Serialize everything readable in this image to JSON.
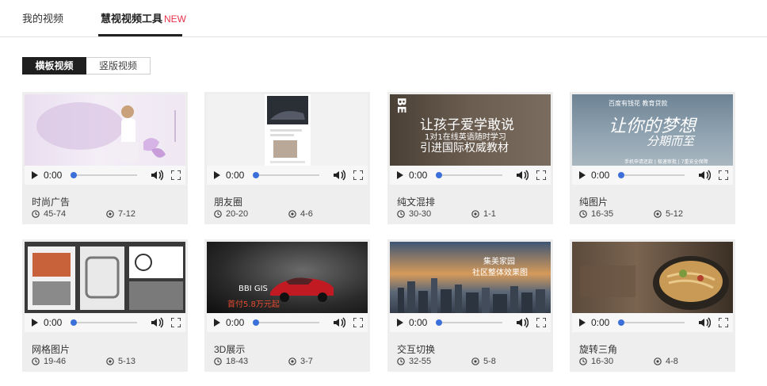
{
  "tabs": {
    "my_videos": "我的视频",
    "tools": "慧视视频工具",
    "tools_badge": "NEW"
  },
  "orientation": {
    "landscape": "横板视频",
    "portrait": "竖版视频"
  },
  "player": {
    "time": "0:00"
  },
  "cards": [
    {
      "title": "时尚广告",
      "duration": "45-74",
      "images": "7-12",
      "progress": 0
    },
    {
      "title": "朋友圈",
      "duration": "20-20",
      "images": "4-6",
      "progress": 0
    },
    {
      "title": "纯文混排",
      "duration": "30-30",
      "images": "1-1",
      "progress": 0,
      "overlay": {
        "l1": "让孩子爱学敢说",
        "l2": "1对1在线英语随时学习",
        "l3": "引进国际权威教材",
        "side": "BE"
      }
    },
    {
      "title": "纯图片",
      "duration": "16-35",
      "images": "5-12",
      "progress": 0,
      "overlay": {
        "brand": "百度有钱花 教育贷款",
        "l1": "让你的梦想",
        "l2": "分期而至",
        "l3": "手机申请还款 | 极速审批 | 7重安全保障"
      }
    },
    {
      "title": "网格图片",
      "duration": "19-46",
      "images": "5-13",
      "progress": 0
    },
    {
      "title": "3D展示",
      "duration": "18-43",
      "images": "3-7",
      "progress": 0,
      "overlay": {
        "l1": "BBI GIS",
        "l2": "首付5.8万元起"
      }
    },
    {
      "title": "交互切换",
      "duration": "32-55",
      "images": "5-8",
      "progress": 0,
      "overlay": {
        "l1": "集美家园",
        "l2": "社区整体效果图"
      }
    },
    {
      "title": "旋转三角",
      "duration": "16-30",
      "images": "4-8",
      "progress": 0
    }
  ],
  "colors": {
    "accent_new": "#e8334a",
    "progress": "#3b6fd9",
    "card_bg": "#eeeeee"
  }
}
